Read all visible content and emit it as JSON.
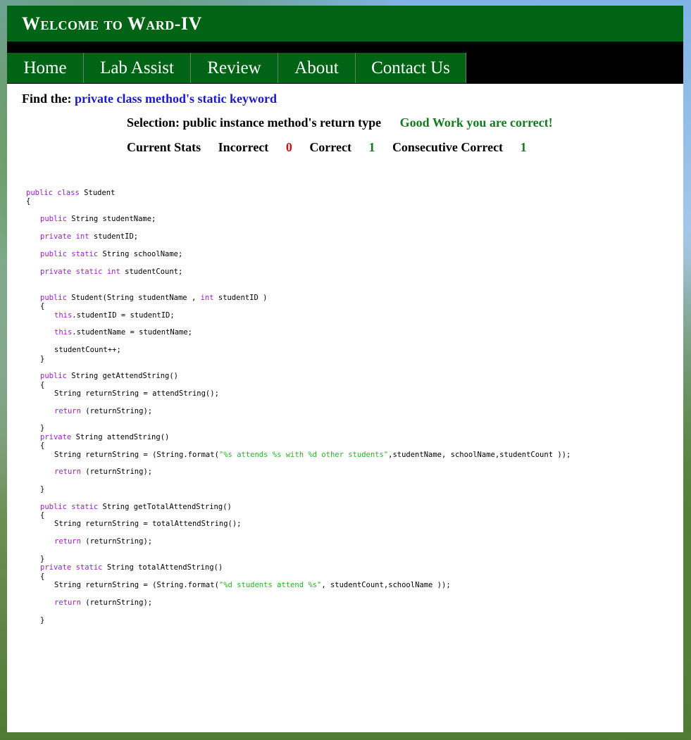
{
  "header": {
    "title": "Welcome to Ward-IV"
  },
  "nav": [
    {
      "label": "Home"
    },
    {
      "label": "Lab Assist"
    },
    {
      "label": "Review"
    },
    {
      "label": "About"
    },
    {
      "label": "Contact Us"
    }
  ],
  "quiz": {
    "find_label": "Find the:",
    "target": "private class method's static keyword",
    "selection_label": "Selection:",
    "selection_value": "public instance method's return type",
    "result": "Good Work you are correct!"
  },
  "stats": {
    "label": "Current Stats",
    "incorrect_label": "Incorrect",
    "incorrect": "0",
    "correct_label": "Correct",
    "correct": "1",
    "consecutive_label": "Consecutive Correct",
    "consecutive": "1"
  },
  "code_lines": [
    {
      "indent": 0,
      "segs": [
        {
          "t": "public class",
          "k": "kw"
        },
        {
          "t": " Student"
        }
      ]
    },
    {
      "indent": 0,
      "segs": [
        {
          "t": "{"
        }
      ]
    },
    {
      "indent": 1,
      "segs": [
        {
          "t": "public",
          "k": "kw"
        },
        {
          "t": " String studentName;"
        }
      ]
    },
    {
      "indent": 1,
      "segs": [
        {
          "t": "private int",
          "k": "kw"
        },
        {
          "t": " studentID;"
        }
      ]
    },
    {
      "indent": 1,
      "segs": [
        {
          "t": "public static",
          "k": "kw"
        },
        {
          "t": " String schoolName;"
        }
      ]
    },
    {
      "indent": 1,
      "segs": [
        {
          "t": "private static int",
          "k": "kw"
        },
        {
          "t": " studentCount;"
        }
      ]
    },
    {
      "indent": 1,
      "segs": [
        {
          "t": "public",
          "k": "kw"
        },
        {
          "t": " Student(String studentName , "
        },
        {
          "t": "int",
          "k": "kw"
        },
        {
          "t": " studentID )"
        }
      ]
    },
    {
      "indent": 1,
      "segs": [
        {
          "t": "{"
        }
      ]
    },
    {
      "indent": 2,
      "segs": [
        {
          "t": "this",
          "k": "kw"
        },
        {
          "t": ".studentID = studentID;"
        }
      ]
    },
    {
      "indent": 2,
      "segs": [
        {
          "t": "this",
          "k": "kw"
        },
        {
          "t": ".studentName = studentName;"
        }
      ]
    },
    {
      "indent": 2,
      "segs": [
        {
          "t": "studentCount++;"
        }
      ]
    },
    {
      "indent": 1,
      "segs": [
        {
          "t": "}"
        }
      ]
    },
    {
      "indent": 1,
      "segs": [
        {
          "t": "public",
          "k": "kw"
        },
        {
          "t": " String getAttendString()"
        }
      ]
    },
    {
      "indent": 1,
      "segs": [
        {
          "t": "{"
        }
      ]
    },
    {
      "indent": 2,
      "segs": [
        {
          "t": "String returnString = attendString();"
        }
      ]
    },
    {
      "indent": 2,
      "segs": [
        {
          "t": "return",
          "k": "kw"
        },
        {
          "t": " (returnString);"
        }
      ]
    },
    {
      "indent": 1,
      "segs": [
        {
          "t": "}"
        }
      ]
    },
    {
      "indent": 1,
      "segs": [
        {
          "t": "private",
          "k": "kw"
        },
        {
          "t": " String attendString()"
        }
      ]
    },
    {
      "indent": 1,
      "segs": [
        {
          "t": "{"
        }
      ]
    },
    {
      "indent": 2,
      "segs": [
        {
          "t": "String returnString = (String.format("
        },
        {
          "t": "\"%s attends %s with %d other students\"",
          "k": "str"
        },
        {
          "t": ",studentName, schoolName,studentCount ));"
        }
      ]
    },
    {
      "indent": 2,
      "segs": [
        {
          "t": "return",
          "k": "kw"
        },
        {
          "t": " (returnString);"
        }
      ]
    },
    {
      "indent": 1,
      "segs": [
        {
          "t": "}"
        }
      ]
    },
    {
      "indent": 1,
      "segs": [
        {
          "t": "public static",
          "k": "kw"
        },
        {
          "t": " String getTotalAttendString()"
        }
      ]
    },
    {
      "indent": 1,
      "segs": [
        {
          "t": "{"
        }
      ]
    },
    {
      "indent": 2,
      "segs": [
        {
          "t": "String returnString = totalAttendString();"
        }
      ]
    },
    {
      "indent": 2,
      "segs": [
        {
          "t": "return",
          "k": "kw"
        },
        {
          "t": " (returnString);"
        }
      ]
    },
    {
      "indent": 1,
      "segs": [
        {
          "t": "}"
        }
      ]
    },
    {
      "indent": 1,
      "segs": [
        {
          "t": "private static",
          "k": "kw"
        },
        {
          "t": " String totalAttendString()"
        }
      ]
    },
    {
      "indent": 1,
      "segs": [
        {
          "t": "{"
        }
      ]
    },
    {
      "indent": 2,
      "segs": [
        {
          "t": "String returnString = (String.format("
        },
        {
          "t": "\"%d students attend %s\"",
          "k": "str"
        },
        {
          "t": ", studentCount,schoolName ));"
        }
      ]
    },
    {
      "indent": 2,
      "segs": [
        {
          "t": "return",
          "k": "kw"
        },
        {
          "t": " (returnString);"
        }
      ]
    },
    {
      "indent": 1,
      "segs": [
        {
          "t": "}"
        }
      ]
    }
  ],
  "colors": {
    "header_bg": "#006414",
    "nav_bg": "#000000",
    "target_text": "#1b17d0",
    "correct_text": "#147a20",
    "incorrect_text": "#c81414",
    "keyword": "#9b20c8",
    "string_literal": "#24b424"
  }
}
